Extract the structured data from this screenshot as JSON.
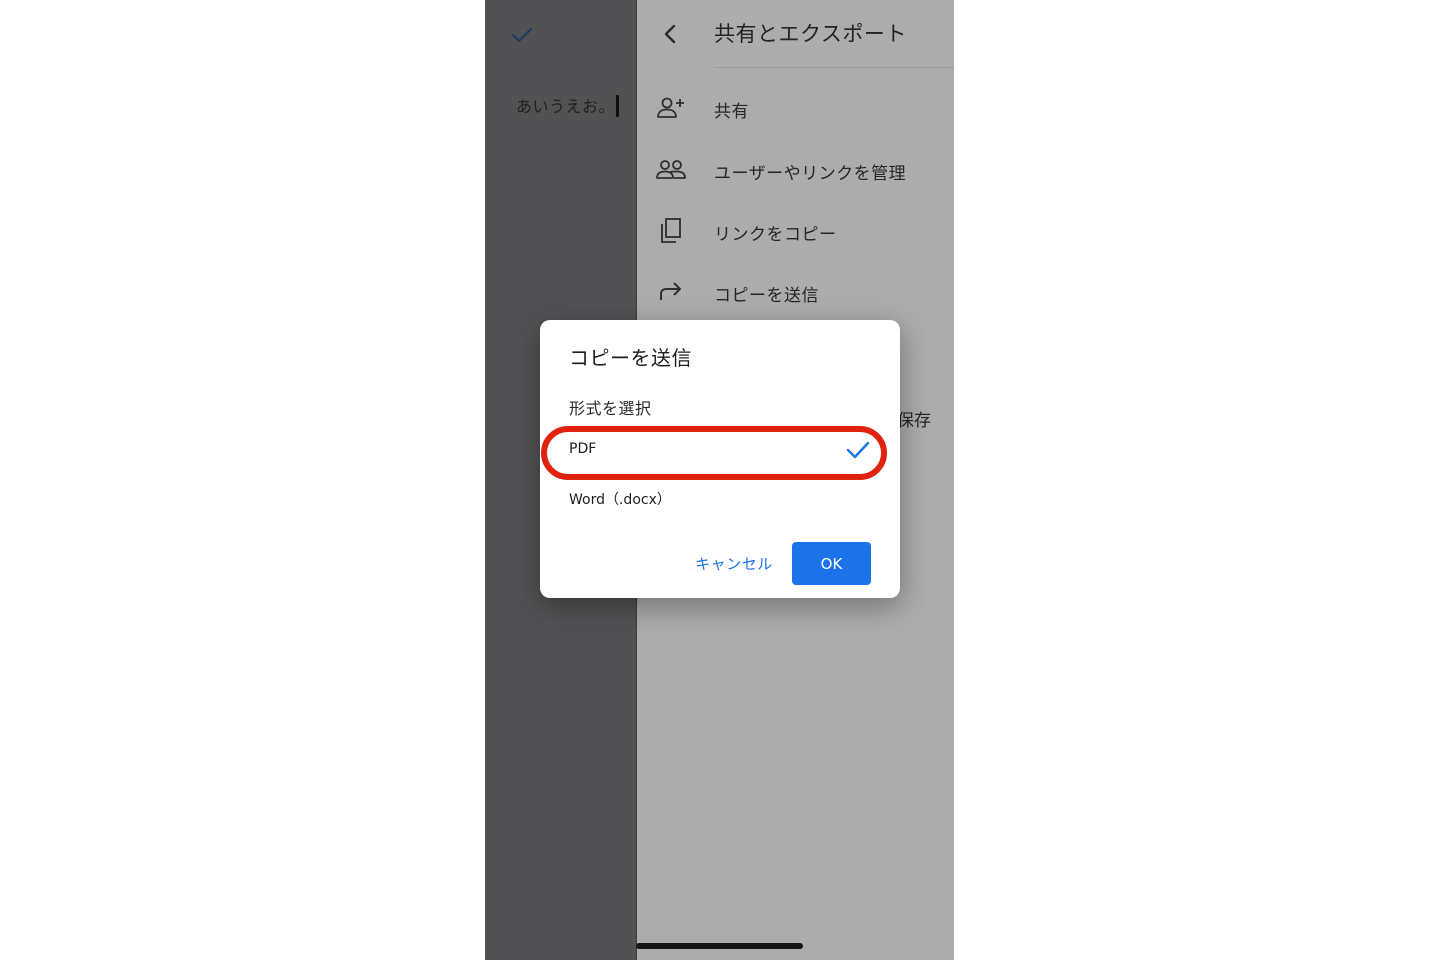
{
  "document": {
    "text": "あいうえお。",
    "done_icon": "check-icon"
  },
  "share_menu": {
    "title": "共有とエクスポート",
    "back_icon": "chevron-left-icon",
    "items": [
      {
        "label": "共有",
        "icon": "person-add-icon"
      },
      {
        "label": "ユーザーやリンクを管理",
        "icon": "people-icon"
      },
      {
        "label": "リンクをコピー",
        "icon": "copy-icon"
      },
      {
        "label": "コピーを送信",
        "icon": "forward-arrow-icon"
      }
    ],
    "partial_item_label": "保存"
  },
  "dialog": {
    "title": "コピーを送信",
    "subtitle": "形式を選択",
    "options": [
      {
        "label": "PDF",
        "selected": true
      },
      {
        "label": "Word（.docx）",
        "selected": false
      }
    ],
    "cancel_label": "キャンセル",
    "ok_label": "OK"
  },
  "colors": {
    "accent": "#1a73e8",
    "highlight_ring": "#e0230e",
    "menu_bg": "#acacac",
    "doc_bg": "#525254"
  }
}
